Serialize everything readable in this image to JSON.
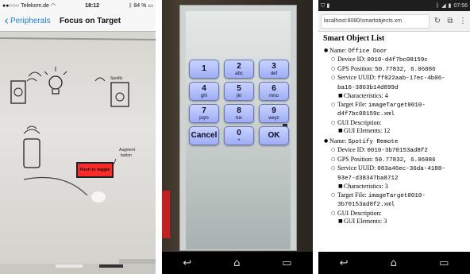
{
  "ios_panel": {
    "status": {
      "carrier": "Telekom.de",
      "time": "18:12",
      "battery": "84 %"
    },
    "nav": {
      "back_label": "Peripherals",
      "title": "Focus on Target"
    },
    "overlay_button": "Push to toggle"
  },
  "keypad_panel": {
    "keys": [
      {
        "digit": "1",
        "letters": ""
      },
      {
        "digit": "2",
        "letters": "abc"
      },
      {
        "digit": "3",
        "letters": "def"
      },
      {
        "digit": "4",
        "letters": "ghi"
      },
      {
        "digit": "5",
        "letters": "jkl"
      },
      {
        "digit": "6",
        "letters": "mno"
      },
      {
        "digit": "7",
        "letters": "pqrs"
      },
      {
        "digit": "8",
        "letters": "tuv"
      },
      {
        "digit": "9",
        "letters": "wxyz"
      },
      {
        "digit": "Cancel",
        "letters": ""
      },
      {
        "digit": "0",
        "letters": "+"
      },
      {
        "digit": "OK",
        "letters": ""
      }
    ]
  },
  "browser_panel": {
    "status": {
      "time": "07:56"
    },
    "url": "localhost:8080/smartobjects.xm",
    "page_title": "Smart Object List",
    "labels": {
      "name": "Name:",
      "device_id": "Device ID:",
      "gps": "GPS Position:",
      "service_uuid": "Service UUID:",
      "characteristics": "Characteristics:",
      "target_file": "Target File:",
      "gui_description": "GUI Description:",
      "gui_elements": "GUI Elements:"
    },
    "objects": [
      {
        "name": "Office Door",
        "device_id": "0010-d4f7bc08159c",
        "gps": "50.77832, 6.06086",
        "service_uuid_1": "ff022aab-17ec-4b06-",
        "service_uuid_2": "ba16-3863b14d899d",
        "characteristics": "4",
        "target_file_1": "imageTarget0010-",
        "target_file_2": "d4f7bc08159c.xml",
        "gui_elements": "12"
      },
      {
        "name": "Spotify Remote",
        "device_id": "0010-3b70153ad8f2",
        "gps": "50.77832, 6.06086",
        "service_uuid_1": "083a46ec-36da-4188-",
        "service_uuid_2": "93e7-d38347ba8712",
        "characteristics": "3",
        "target_file_1": "imageTarget0010-",
        "target_file_2": "3b70153ad8f2.xml",
        "gui_elements": "3"
      }
    ]
  }
}
